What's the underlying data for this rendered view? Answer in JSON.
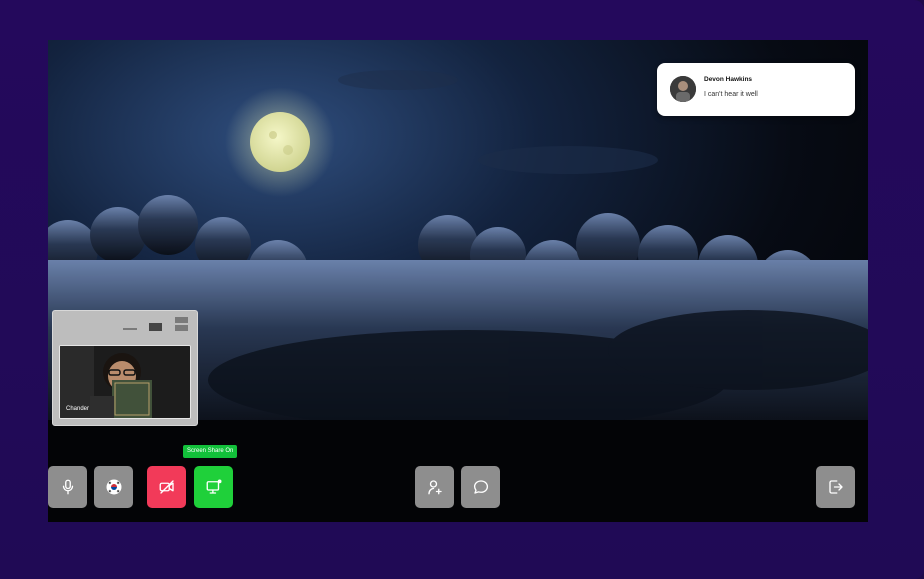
{
  "chat": {
    "sender": "Devon Hawkins",
    "message": "I can't hear it well"
  },
  "pip": {
    "participant": "Chander"
  },
  "controls": {
    "screen_share_tooltip": "Screen Share On"
  },
  "colors": {
    "background": "#200a55",
    "control_gray": "#8e8e8e",
    "camera_off_red": "#f23a59",
    "screen_share_green": "#1fd03a"
  },
  "icons": [
    "microphone-icon",
    "flag-icon",
    "camera-off-icon",
    "screen-share-icon",
    "add-participant-icon",
    "chat-icon",
    "leave-icon"
  ]
}
